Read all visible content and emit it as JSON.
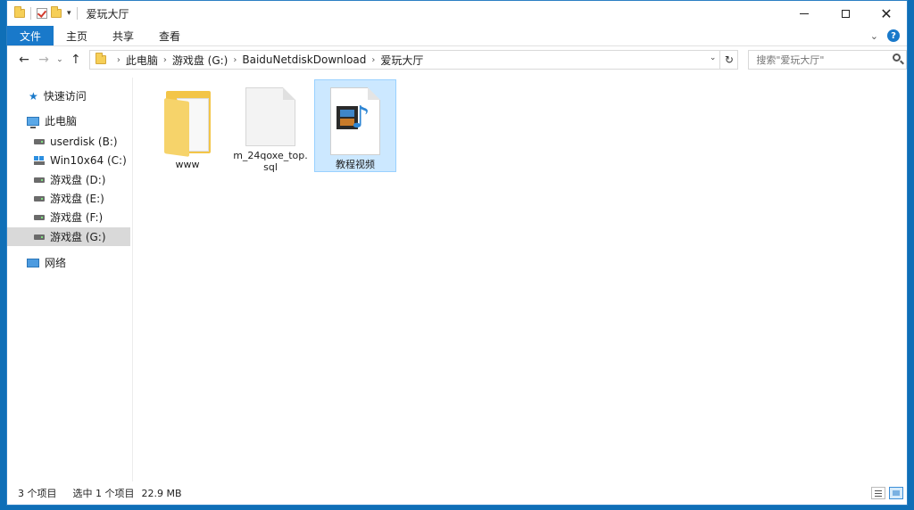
{
  "window": {
    "title": "爱玩大厅"
  },
  "ribbon": {
    "tabs": [
      "文件",
      "主页",
      "共享",
      "查看"
    ]
  },
  "address": {
    "crumbs": [
      "此电脑",
      "游戏盘 (G:)",
      "BaiduNetdiskDownload",
      "爱玩大厅"
    ]
  },
  "search": {
    "placeholder": "搜索\"爱玩大厅\""
  },
  "nav": {
    "quick_access": "快速访问",
    "this_pc": "此电脑",
    "drives": [
      "userdisk (B:)",
      "Win10x64 (C:)",
      "游戏盘 (D:)",
      "游戏盘 (E:)",
      "游戏盘 (F:)",
      "游戏盘 (G:)"
    ],
    "network": "网络"
  },
  "files": [
    {
      "name": "www",
      "type": "folder",
      "selected": false
    },
    {
      "name": "m_24qoxe_top.sql",
      "type": "file",
      "selected": false
    },
    {
      "name": "教程视频",
      "type": "video",
      "selected": true
    }
  ],
  "status": {
    "count": "3 个项目",
    "selection": "选中 1 个项目",
    "size": "22.9 MB"
  },
  "colors": {
    "accent": "#1979ca",
    "selection": "#cce8ff",
    "desktop": "#0f6fb7"
  }
}
